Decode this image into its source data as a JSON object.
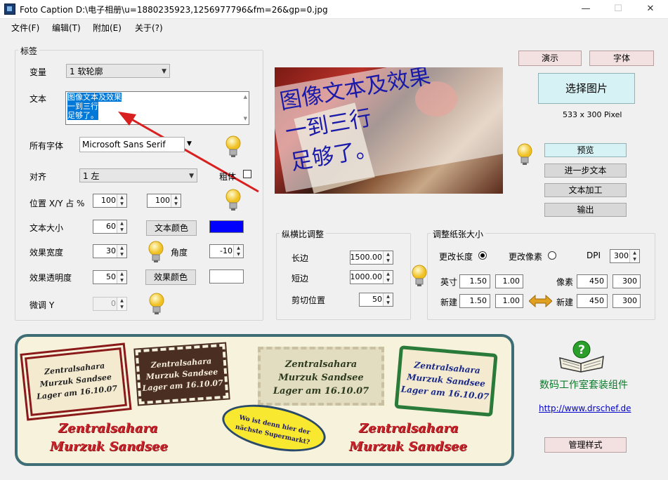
{
  "window": {
    "title": "Foto Caption D:\\电子相册\\u=1880235923,1256977796&fm=26&gp=0.jpg",
    "minimize": "—",
    "maximize": "☐",
    "close": "✕"
  },
  "menu": [
    "文件(F)",
    "编辑(T)",
    "附加(E)",
    "关于(?)"
  ],
  "label_group": {
    "title": "标签",
    "variant_label": "变量",
    "variant_value": "1 软轮廓",
    "text_label": "文本",
    "text_lines": [
      "图像文本及效果",
      "一到三行",
      "足够了。"
    ],
    "all_fonts_label": "所有字体",
    "font_value": "Microsoft Sans Serif",
    "align_label": "对齐",
    "align_value": "1 左",
    "bold_label": "粗体",
    "pos_label": "位置 X/Y 占 %",
    "pos_x": "100",
    "pos_y": "100",
    "size_label": "文本大小",
    "size_value": "60",
    "text_color_btn": "文本颜色",
    "text_color": "#0000ff",
    "effect_width_label": "效果宽度",
    "effect_width_value": "30",
    "angle_label": "角度",
    "angle_value": "-10",
    "effect_opacity_label": "效果透明度",
    "effect_opacity_value": "50",
    "effect_color_btn": "效果颜色",
    "effect_color": "#ffffff",
    "fine_y_label": "微调 Y",
    "fine_y_value": "0"
  },
  "preview": {
    "lines": [
      "图像文本及效果",
      "一到三行",
      "足够了。"
    ]
  },
  "right_buttons": {
    "demo": "演示",
    "font": "字体",
    "choose_image": "选择图片",
    "pixel_info": "533 x 300 Pixel",
    "preview": "预览",
    "more_text": "进一步文本",
    "text_process": "文本加工",
    "output": "输出"
  },
  "aspect_group": {
    "title": "纵横比调整",
    "long_label": "长边",
    "long_value": "1500.00",
    "short_label": "短边",
    "short_value": "1000.00",
    "crop_label": "剪切位置",
    "crop_value": "50"
  },
  "paper_group": {
    "title": "调整纸张大小",
    "change_length": "更改长度",
    "change_pixel": "更改像素",
    "dpi_label": "DPI",
    "dpi_value": "300",
    "inch_label": "英寸",
    "inch_w": "1.50",
    "inch_h": "1.00",
    "pixel_label": "像素",
    "pixel_w": "450",
    "pixel_h": "300",
    "new_label": "新建",
    "new_w": "1.50",
    "new_h": "1.00",
    "new2_label": "新建",
    "new2_w": "450",
    "new2_h": "300"
  },
  "banner": {
    "stamp1": [
      "Zentralsahara",
      "Murzuk Sandsee",
      "Lager am 16.10.07"
    ],
    "stamp2": [
      "Zentralsahara",
      "Murzuk Sandsee",
      "Lager am 16.10.07"
    ],
    "stamp3": [
      "Zentralsahara",
      "Murzuk Sandsee",
      "Lager am 16.10.07"
    ],
    "stamp4": [
      "Zentralsahara",
      "Murzuk Sandsee",
      "Lager am 16.10.07"
    ],
    "bubble": [
      "Wo ist denn hier der",
      "nächste Supermarkt?"
    ],
    "red_left": [
      "Zentralsahara",
      "Murzuk Sandsee"
    ],
    "red_right": [
      "Zentralsahara",
      "Murzuk Sandsee"
    ]
  },
  "suite": {
    "name": "数码工作室套装组件",
    "url": "http://www.drschef.de",
    "manage_btn": "管理样式"
  },
  "colors": {
    "accent_blue": "#0000ff",
    "banner_border": "#3e6d75",
    "stamp_red": "#c8232a"
  }
}
